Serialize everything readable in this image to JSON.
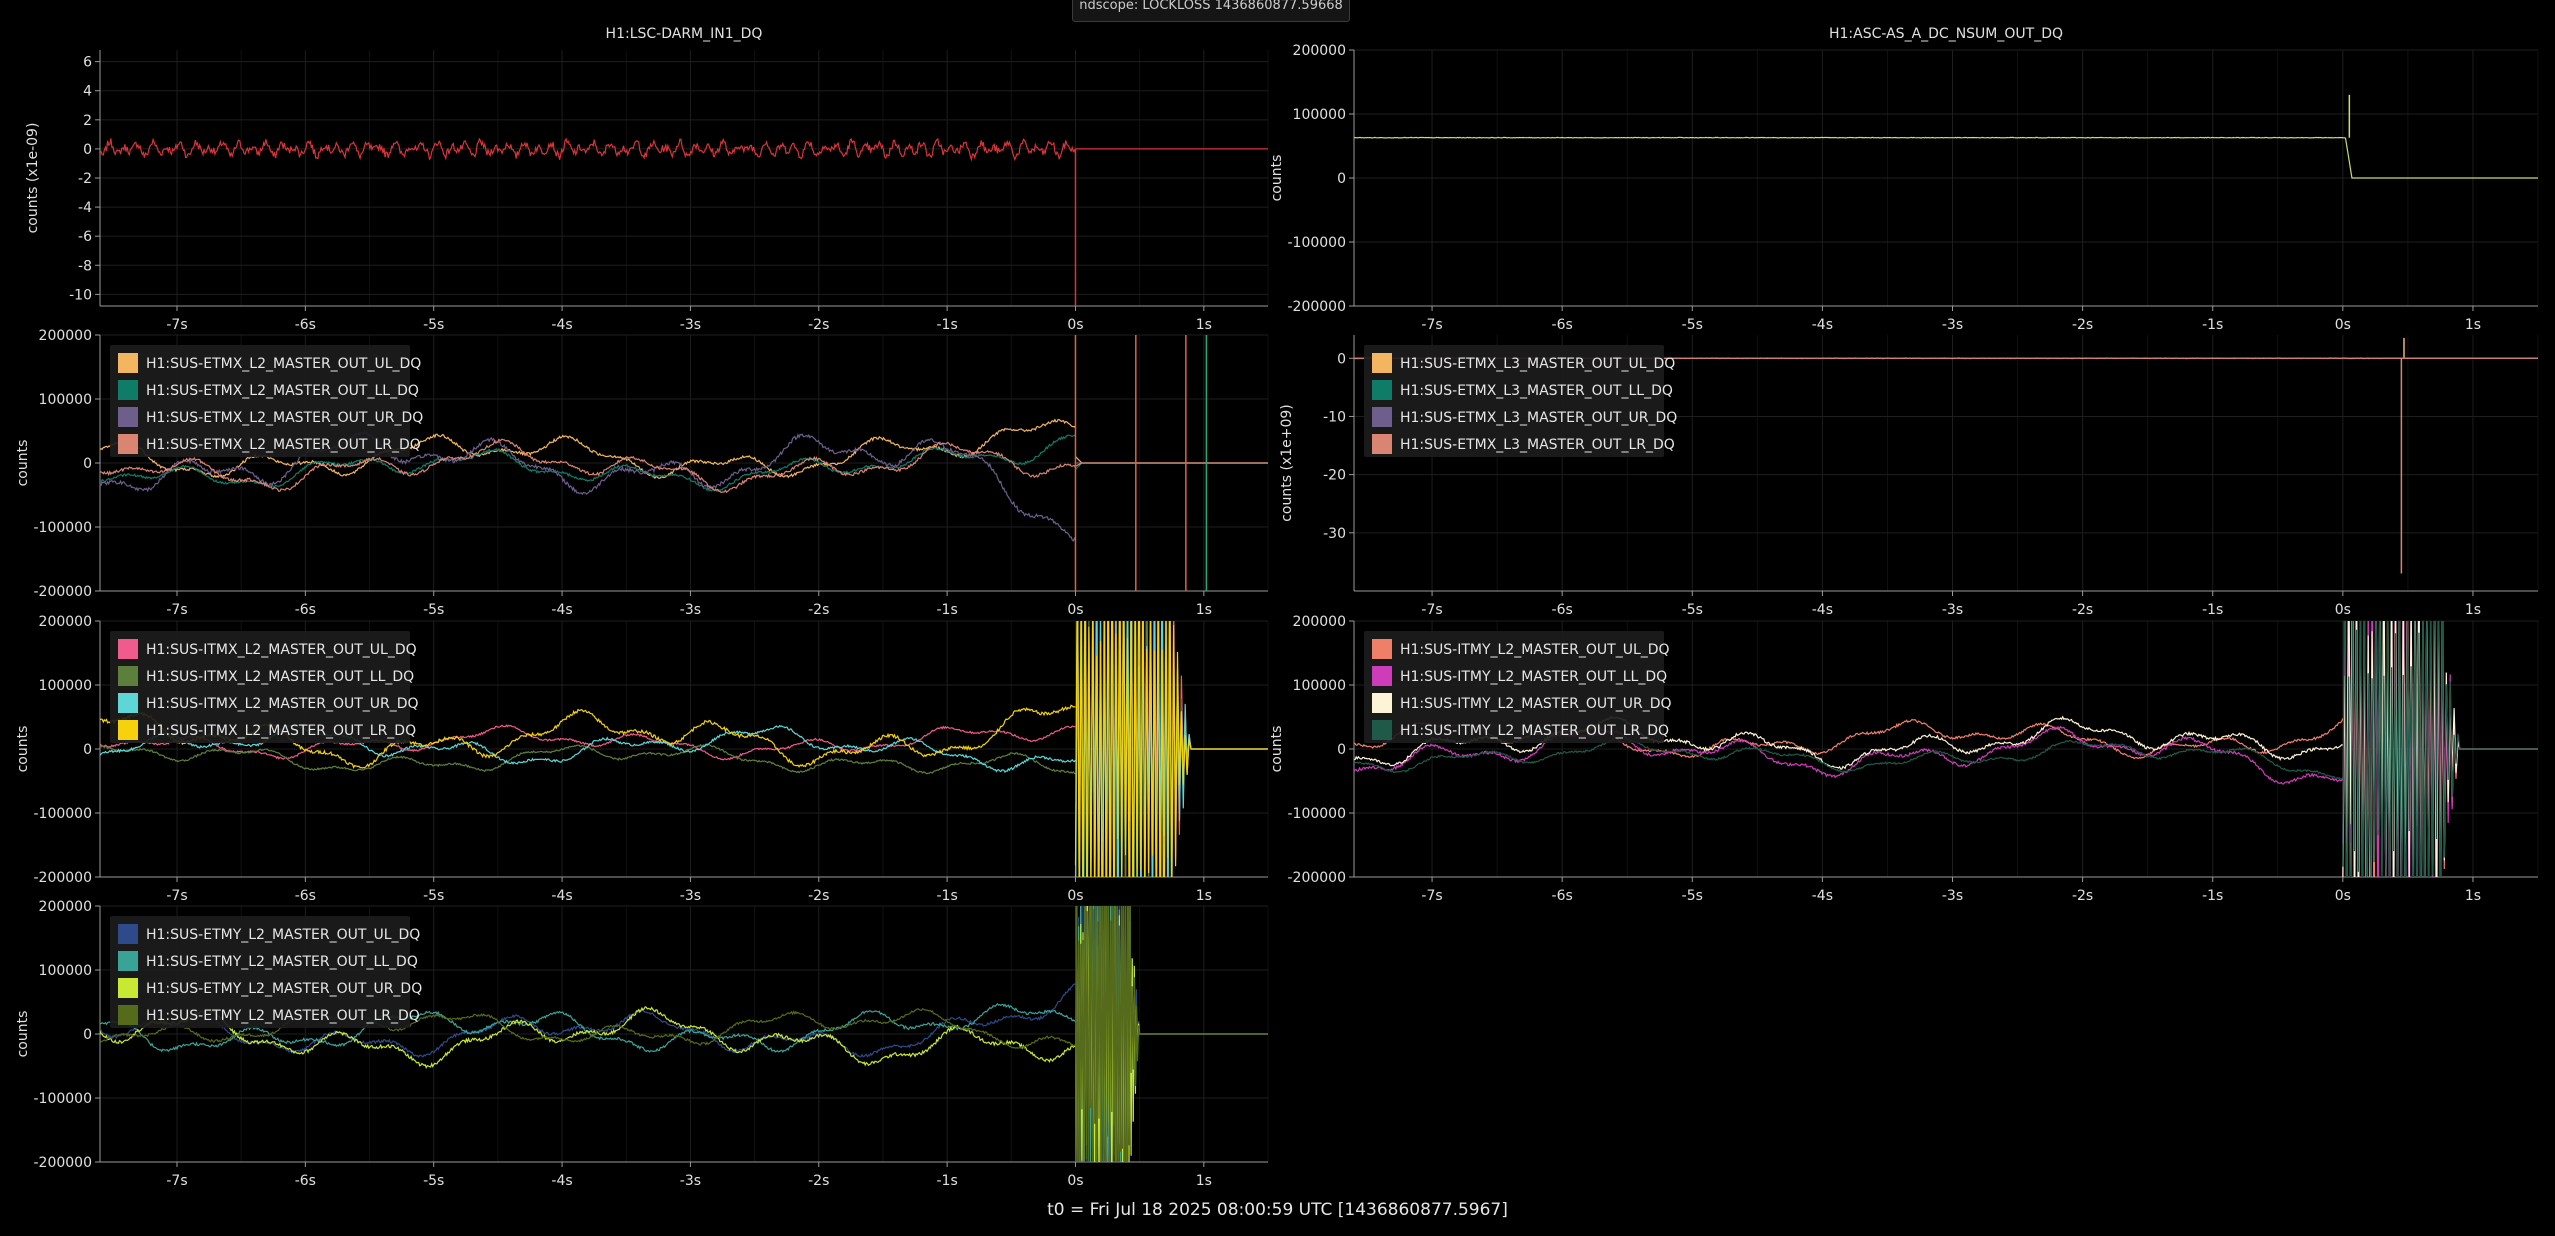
{
  "window": {
    "title": "ndscope"
  },
  "tooltip": "ndscope: LOCKLOSS 1436860877.59668",
  "footer": "t0 = Fri Jul 18 2025 08:00:59 UTC [1436860877.5967]",
  "colors": {
    "background": "#000000",
    "axis": "#9a9a9a",
    "grid": "#1e1e1e"
  },
  "x_ticks": [
    -7,
    -6,
    -5,
    -4,
    -3,
    -2,
    -1,
    0,
    1
  ],
  "x_tick_format": "{v}s",
  "x_range": [
    -7.6,
    1.5
  ],
  "panels": [
    {
      "id": "darm",
      "title": "H1:LSC-DARM_IN1_DQ",
      "ylabel": "counts (x1e-09)",
      "chart_data": {
        "type": "line",
        "xlabel": "",
        "ylabel": "counts (x1e-09)",
        "xlim": [
          -7.6,
          1.5
        ],
        "ylim": [
          -10.8,
          6.8
        ],
        "yticks": [
          6,
          4,
          2,
          0,
          -2,
          -4,
          -6,
          -8,
          -10
        ],
        "series": [
          {
            "color": "#d9343a",
            "kind": "noise",
            "base": 0,
            "amp": 0.6,
            "freq": 9,
            "end": 0.0,
            "after": 0,
            "spike": [
              0.0,
              -10.8
            ]
          }
        ]
      }
    },
    {
      "id": "as_nsum",
      "title": "H1:ASC-AS_A_DC_NSUM_OUT_DQ",
      "ylabel": "counts",
      "chart_data": {
        "type": "line",
        "xlabel": "",
        "ylabel": "counts",
        "xlim": [
          -7.6,
          1.5
        ],
        "ylim": [
          -200000,
          200000
        ],
        "yticks": [
          200000,
          100000,
          0,
          -100000,
          -200000
        ],
        "series": [
          {
            "color": "#c9e06a",
            "kind": "flat",
            "base": 63000,
            "end": 0.02,
            "after": 0,
            "spike": [
              0.05,
              130000
            ]
          }
        ]
      }
    },
    {
      "id": "etmx_l2",
      "ylabel": "counts",
      "legend": [
        "H1:SUS-ETMX_L2_MASTER_OUT_UL_DQ",
        "H1:SUS-ETMX_L2_MASTER_OUT_LL_DQ",
        "H1:SUS-ETMX_L2_MASTER_OUT_UR_DQ",
        "H1:SUS-ETMX_L2_MASTER_OUT_LR_DQ"
      ],
      "chart_data": {
        "type": "line",
        "xlabel": "",
        "ylabel": "counts",
        "xlim": [
          -7.6,
          1.5
        ],
        "ylim": [
          -200000,
          200000
        ],
        "yticks": [
          200000,
          100000,
          0,
          -100000,
          -200000
        ],
        "series": [
          {
            "name": "H1:SUS-ETMX_L2_MASTER_OUT_UL_DQ",
            "color": "#f4b560",
            "kind": "wander",
            "base": 10000,
            "amp": 30000,
            "end": 0.0,
            "after": 0,
            "trend": 90000
          },
          {
            "name": "H1:SUS-ETMX_L2_MASTER_OUT_LL_DQ",
            "color": "#0f7c68",
            "kind": "wander",
            "base": -10000,
            "amp": 25000,
            "end": 0.0,
            "after": 0,
            "trend": 110000
          },
          {
            "name": "H1:SUS-ETMX_L2_MASTER_OUT_UR_DQ",
            "color": "#6e5e8c",
            "kind": "wander",
            "base": 0,
            "amp": 40000,
            "end": 0.0,
            "after": 0,
            "trend": -190000
          },
          {
            "name": "H1:SUS-ETMX_L2_MASTER_OUT_LR_DQ",
            "color": "#d98572",
            "kind": "wander",
            "base": -5000,
            "amp": 30000,
            "end": 0.0,
            "after": 0,
            "trend": -20000
          }
        ],
        "vlines": [
          {
            "x": 0.0,
            "color": "#e0643c"
          },
          {
            "x": 0.47,
            "color": "#e0643c"
          },
          {
            "x": 0.86,
            "color": "#e0643c"
          },
          {
            "x": 1.02,
            "color": "#2aa87a"
          }
        ]
      }
    },
    {
      "id": "etmx_l3",
      "ylabel": "counts (x1e+09)",
      "legend": [
        "H1:SUS-ETMX_L3_MASTER_OUT_UL_DQ",
        "H1:SUS-ETMX_L3_MASTER_OUT_LL_DQ",
        "H1:SUS-ETMX_L3_MASTER_OUT_UR_DQ",
        "H1:SUS-ETMX_L3_MASTER_OUT_LR_DQ"
      ],
      "chart_data": {
        "type": "line",
        "xlabel": "",
        "ylabel": "counts (x1e+09)",
        "xlim": [
          -7.6,
          1.5
        ],
        "ylim": [
          -40,
          4
        ],
        "yticks": [
          0,
          -10,
          -20,
          -30
        ],
        "series": [
          {
            "name": "H1:SUS-ETMX_L3_MASTER_OUT_UL_DQ",
            "color": "#f4b560",
            "kind": "flat",
            "base": 0,
            "end": 0.3,
            "after": 0,
            "spike": [
              0.47,
              3.5
            ]
          },
          {
            "name": "H1:SUS-ETMX_L3_MASTER_OUT_LL_DQ",
            "color": "#0f7c68",
            "kind": "flat",
            "base": 0,
            "end": 0.3,
            "after": 0
          },
          {
            "name": "H1:SUS-ETMX_L3_MASTER_OUT_UR_DQ",
            "color": "#6e5e8c",
            "kind": "flat",
            "base": 0,
            "end": 0.3,
            "after": 0
          },
          {
            "name": "H1:SUS-ETMX_L3_MASTER_OUT_LR_DQ",
            "color": "#d98572",
            "kind": "flat",
            "base": 0,
            "end": 0.3,
            "after": 0,
            "spike": [
              0.45,
              -37
            ]
          }
        ]
      }
    },
    {
      "id": "itmx_l2",
      "ylabel": "counts",
      "legend": [
        "H1:SUS-ITMX_L2_MASTER_OUT_UL_DQ",
        "H1:SUS-ITMX_L2_MASTER_OUT_LL_DQ",
        "H1:SUS-ITMX_L2_MASTER_OUT_UR_DQ",
        "H1:SUS-ITMX_L2_MASTER_OUT_LR_DQ"
      ],
      "chart_data": {
        "type": "line",
        "xlabel": "",
        "ylabel": "counts",
        "xlim": [
          -7.6,
          1.5
        ],
        "ylim": [
          -200000,
          200000
        ],
        "yticks": [
          200000,
          100000,
          0,
          -100000,
          -200000
        ],
        "series": [
          {
            "name": "H1:SUS-ITMX_L2_MASTER_OUT_UL_DQ",
            "color": "#ef5b8c",
            "kind": "wander",
            "base": 10000,
            "amp": 20000,
            "end": 0.0,
            "after": 0.9,
            "trend": 30000
          },
          {
            "name": "H1:SUS-ITMX_L2_MASTER_OUT_LL_DQ",
            "color": "#5d7f3c",
            "kind": "wander",
            "base": -15000,
            "amp": 20000,
            "end": 0.0,
            "after": 0.9,
            "trend": -60000
          },
          {
            "name": "H1:SUS-ITMX_L2_MASTER_OUT_UR_DQ",
            "color": "#5fd6d6",
            "kind": "wander",
            "base": 5000,
            "amp": 25000,
            "end": 0.0,
            "after": 0.9,
            "trend": -50000
          },
          {
            "name": "H1:SUS-ITMX_L2_MASTER_OUT_LR_DQ",
            "color": "#f5d20c",
            "kind": "wander",
            "base": 15000,
            "amp": 35000,
            "end": 0.0,
            "after": 0.9,
            "trend": 50000
          }
        ]
      }
    },
    {
      "id": "itmy_l2",
      "ylabel": "counts",
      "legend": [
        "H1:SUS-ITMY_L2_MASTER_OUT_UL_DQ",
        "H1:SUS-ITMY_L2_MASTER_OUT_LL_DQ",
        "H1:SUS-ITMY_L2_MASTER_OUT_UR_DQ",
        "H1:SUS-ITMY_L2_MASTER_OUT_LR_DQ"
      ],
      "chart_data": {
        "type": "line",
        "xlabel": "",
        "ylabel": "counts",
        "xlim": [
          -7.6,
          1.5
        ],
        "ylim": [
          -200000,
          200000
        ],
        "yticks": [
          200000,
          100000,
          0,
          -100000,
          -200000
        ],
        "series": [
          {
            "name": "H1:SUS-ITMY_L2_MASTER_OUT_UL_DQ",
            "color": "#f07f6a",
            "kind": "wander",
            "base": 15000,
            "amp": 25000,
            "end": 0.0,
            "after": 0.9,
            "trend": 30000
          },
          {
            "name": "H1:SUS-ITMY_L2_MASTER_OUT_LL_DQ",
            "color": "#cf3cba",
            "kind": "wander",
            "base": -5000,
            "amp": 30000,
            "end": 0.0,
            "after": 0.9,
            "trend": -60000
          },
          {
            "name": "H1:SUS-ITMY_L2_MASTER_OUT_UR_DQ",
            "color": "#fdf3d6",
            "kind": "wander",
            "base": 10000,
            "amp": 30000,
            "end": 0.0,
            "after": 0.9,
            "trend": 40000
          },
          {
            "name": "H1:SUS-ITMY_L2_MASTER_OUT_LR_DQ",
            "color": "#1f5a48",
            "kind": "wander",
            "base": -10000,
            "amp": 20000,
            "end": 0.0,
            "after": 0.9,
            "trend": -30000
          }
        ]
      }
    },
    {
      "id": "etmy_l2",
      "ylabel": "counts",
      "legend": [
        "H1:SUS-ETMY_L2_MASTER_OUT_UL_DQ",
        "H1:SUS-ETMY_L2_MASTER_OUT_LL_DQ",
        "H1:SUS-ETMY_L2_MASTER_OUT_UR_DQ",
        "H1:SUS-ETMY_L2_MASTER_OUT_LR_DQ"
      ],
      "chart_data": {
        "type": "line",
        "xlabel": "",
        "ylabel": "counts",
        "xlim": [
          -7.6,
          1.5
        ],
        "ylim": [
          -200000,
          200000
        ],
        "yticks": [
          200000,
          100000,
          0,
          -100000,
          -200000
        ],
        "series": [
          {
            "name": "H1:SUS-ETMY_L2_MASTER_OUT_UL_DQ",
            "color": "#2e4a8a",
            "kind": "wander",
            "base": 0,
            "amp": 30000,
            "end": 0.0,
            "after": 0.5,
            "trend": 100000
          },
          {
            "name": "H1:SUS-ETMY_L2_MASTER_OUT_LL_DQ",
            "color": "#3aa398",
            "kind": "wander",
            "base": 5000,
            "amp": 30000,
            "end": 0.0,
            "after": 0.5,
            "trend": 60000
          },
          {
            "name": "H1:SUS-ETMY_L2_MASTER_OUT_UR_DQ",
            "color": "#c8e834",
            "kind": "wander",
            "base": -5000,
            "amp": 35000,
            "end": 0.0,
            "after": 0.5,
            "trend": -80000
          },
          {
            "name": "H1:SUS-ETMY_L2_MASTER_OUT_LR_DQ",
            "color": "#556a1a",
            "kind": "wander",
            "base": 10000,
            "amp": 25000,
            "end": 0.0,
            "after": 0.5,
            "trend": -40000
          }
        ]
      }
    }
  ]
}
